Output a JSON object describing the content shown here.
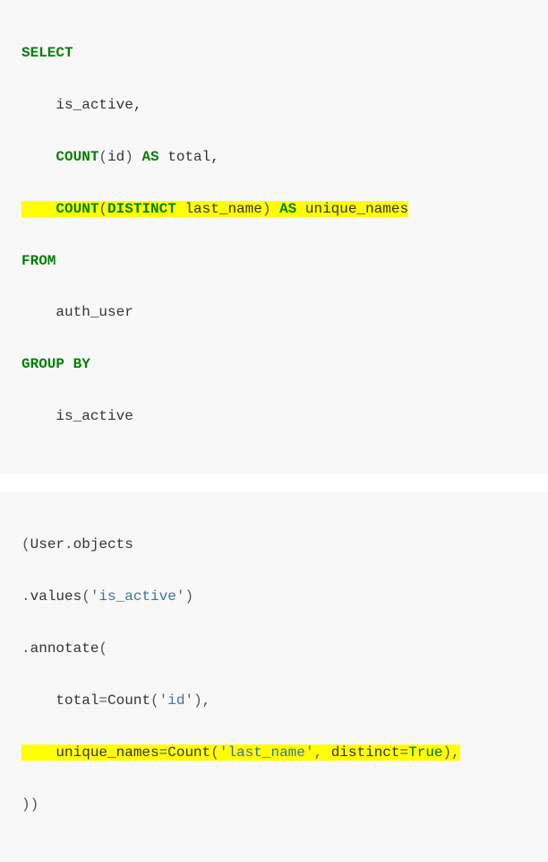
{
  "sql": {
    "line1_kw": "SELECT",
    "line2_indent": "    ",
    "line2_txt": "is_active,",
    "line3_indent": "    ",
    "line3_kw1": "COUNT",
    "line3_p1": "(",
    "line3_txt1": "id",
    "line3_p2": ") ",
    "line3_kw2": "AS",
    "line3_txt2": " total,",
    "line4_indent": "    ",
    "line4_kw1": "COUNT",
    "line4_p1": "(",
    "line4_kw2": "DISTINCT",
    "line4_txt1": " last_name",
    "line4_p2": ") ",
    "line4_kw3": "AS",
    "line4_txt2": " unique_names",
    "line5_kw": "FROM",
    "line6_indent": "    ",
    "line6_txt": "auth_user",
    "line7_kw1": "GROUP",
    "line7_sp": " ",
    "line7_kw2": "BY",
    "line8_indent": "    ",
    "line8_txt": "is_active"
  },
  "py": {
    "line1_p1": "(",
    "line1_txt1": "User",
    "line1_p2": ".",
    "line1_txt2": "objects",
    "line2_p1": ".",
    "line2_txt1": "values",
    "line2_p2": "(",
    "line2_str": "'is_active'",
    "line2_p3": ")",
    "line3_p1": ".",
    "line3_txt1": "annotate",
    "line3_p2": "(",
    "line4_indent": "    ",
    "line4_txt1": "total",
    "line4_p1": "=",
    "line4_txt2": "Count",
    "line4_p2": "(",
    "line4_str": "'id'",
    "line4_p3": "),",
    "line5_indent": "    ",
    "line5_txt1": "unique_names",
    "line5_p1": "=",
    "line5_txt2": "Count",
    "line5_p2": "(",
    "line5_str": "'last_name'",
    "line5_p3": ", ",
    "line5_txt3": "distinct",
    "line5_p4": "=",
    "line5_lit": "True",
    "line5_p5": "),",
    "line6_p": "))"
  }
}
